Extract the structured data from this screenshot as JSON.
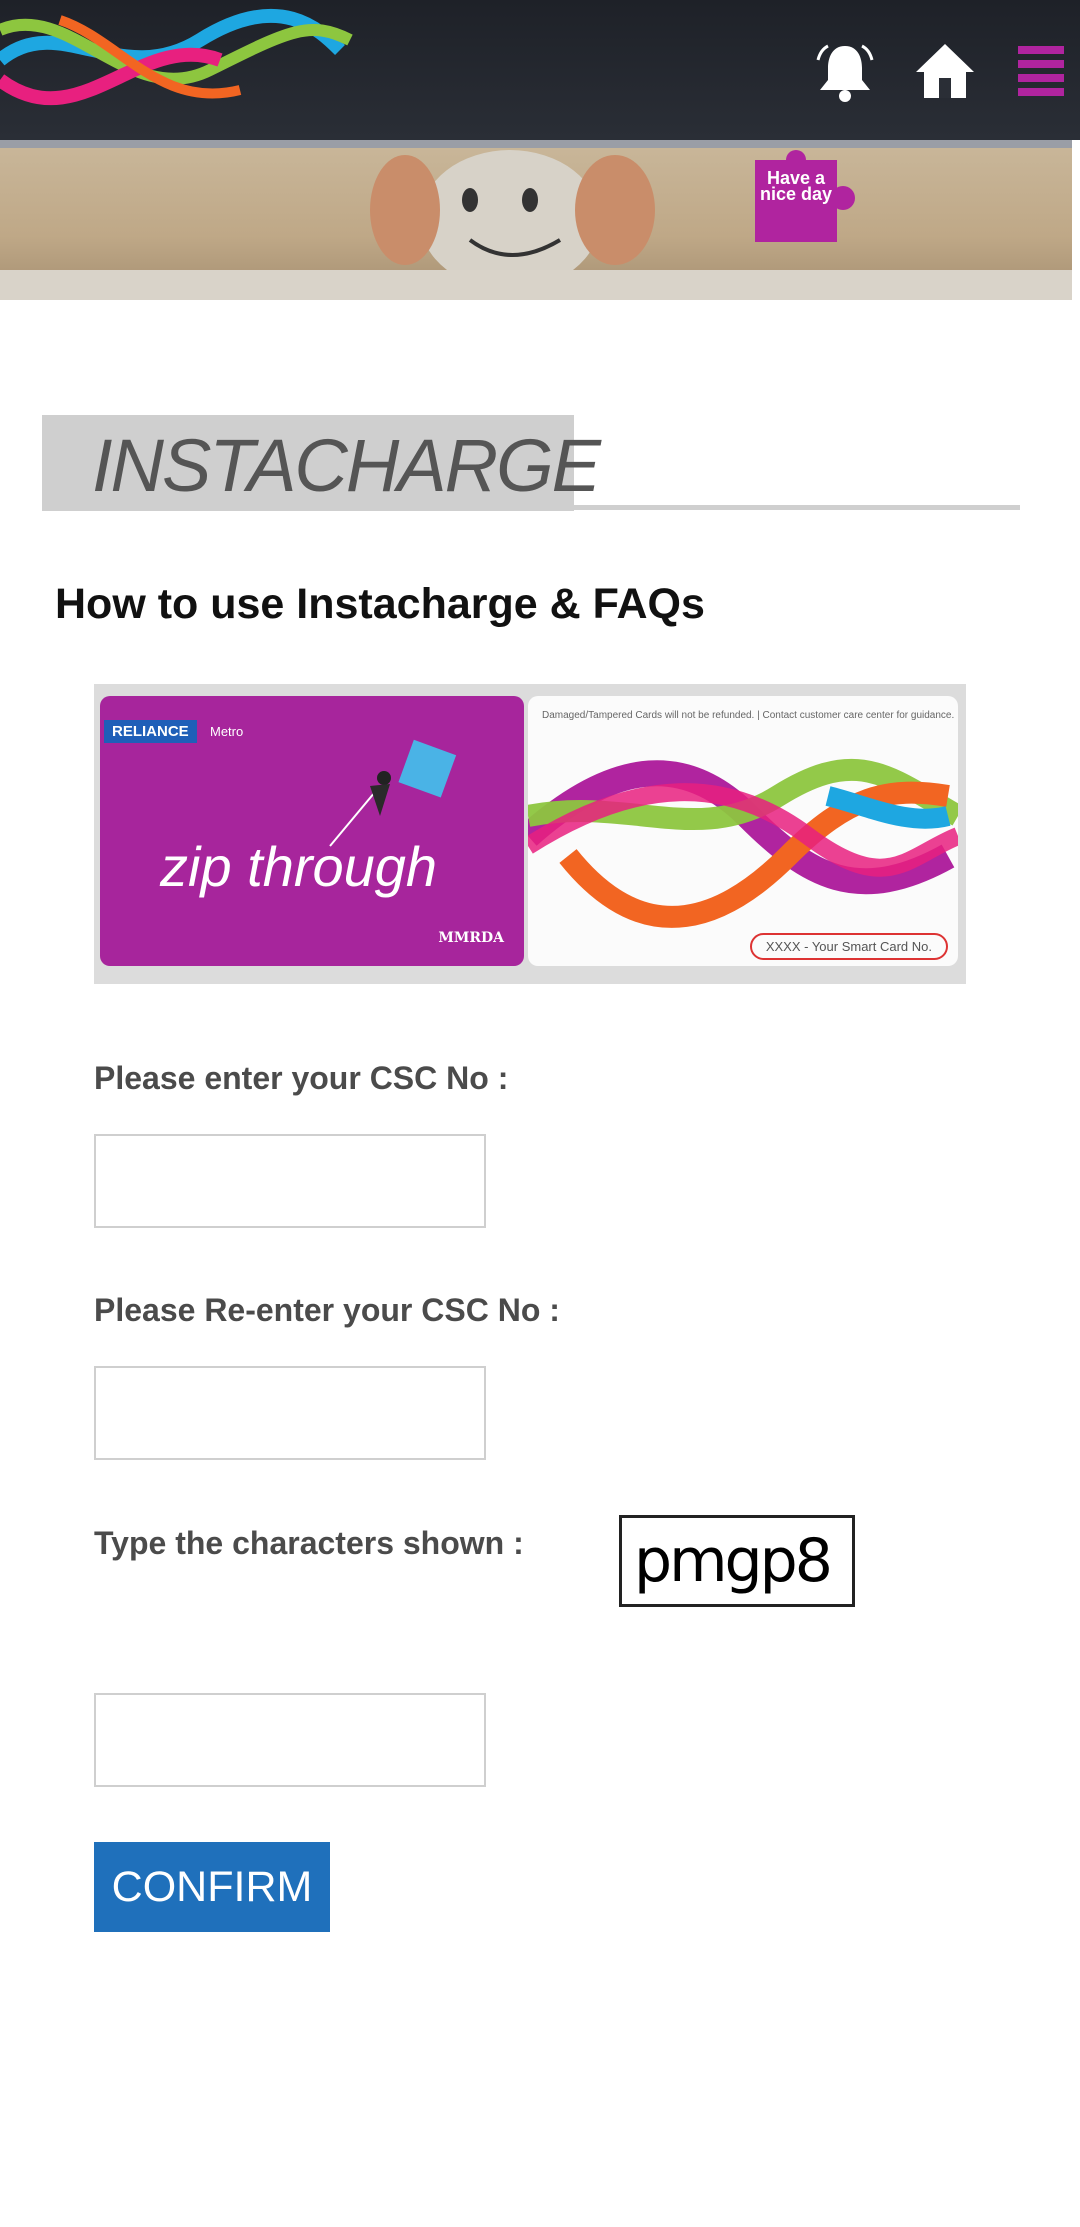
{
  "header": {
    "icons": [
      "notification-bell-icon",
      "home-icon",
      "hamburger-menu-icon"
    ],
    "accent_color": "#b0249f"
  },
  "banner": {
    "badge_text": "Have a nice day"
  },
  "section": {
    "title": "INSTACHARGE"
  },
  "faq": {
    "link_text": "How to use Instacharge & FAQs"
  },
  "card": {
    "brand": "RELIANCE",
    "brand_sub": "Metro",
    "slogan": "zip through",
    "badge": "Have a nice day",
    "issuer": "MMRDA",
    "note": "Damaged/Tampered Cards will not be refunded. | Contact customer care center for guidance.",
    "number_hint": "XXXX - Your Smart Card No."
  },
  "form": {
    "csc_label": "Please enter your CSC No :",
    "csc_value": "",
    "csc_reenter_label": "Please Re-enter your CSC No :",
    "csc_reenter_value": "",
    "captcha_label": "Type the characters shown :",
    "captcha_text": "pmgp8",
    "captcha_value": "",
    "confirm_label": "CONFIRM"
  }
}
